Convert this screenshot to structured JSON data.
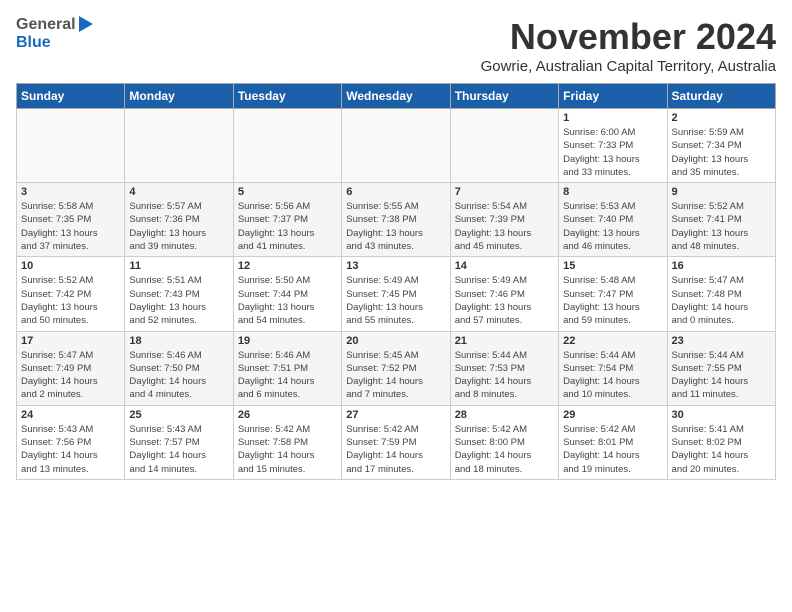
{
  "header": {
    "logo_general": "General",
    "logo_blue": "Blue",
    "month": "November 2024",
    "location": "Gowrie, Australian Capital Territory, Australia"
  },
  "weekdays": [
    "Sunday",
    "Monday",
    "Tuesday",
    "Wednesday",
    "Thursday",
    "Friday",
    "Saturday"
  ],
  "weeks": [
    [
      {
        "day": "",
        "info": ""
      },
      {
        "day": "",
        "info": ""
      },
      {
        "day": "",
        "info": ""
      },
      {
        "day": "",
        "info": ""
      },
      {
        "day": "",
        "info": ""
      },
      {
        "day": "1",
        "info": "Sunrise: 6:00 AM\nSunset: 7:33 PM\nDaylight: 13 hours\nand 33 minutes."
      },
      {
        "day": "2",
        "info": "Sunrise: 5:59 AM\nSunset: 7:34 PM\nDaylight: 13 hours\nand 35 minutes."
      }
    ],
    [
      {
        "day": "3",
        "info": "Sunrise: 5:58 AM\nSunset: 7:35 PM\nDaylight: 13 hours\nand 37 minutes."
      },
      {
        "day": "4",
        "info": "Sunrise: 5:57 AM\nSunset: 7:36 PM\nDaylight: 13 hours\nand 39 minutes."
      },
      {
        "day": "5",
        "info": "Sunrise: 5:56 AM\nSunset: 7:37 PM\nDaylight: 13 hours\nand 41 minutes."
      },
      {
        "day": "6",
        "info": "Sunrise: 5:55 AM\nSunset: 7:38 PM\nDaylight: 13 hours\nand 43 minutes."
      },
      {
        "day": "7",
        "info": "Sunrise: 5:54 AM\nSunset: 7:39 PM\nDaylight: 13 hours\nand 45 minutes."
      },
      {
        "day": "8",
        "info": "Sunrise: 5:53 AM\nSunset: 7:40 PM\nDaylight: 13 hours\nand 46 minutes."
      },
      {
        "day": "9",
        "info": "Sunrise: 5:52 AM\nSunset: 7:41 PM\nDaylight: 13 hours\nand 48 minutes."
      }
    ],
    [
      {
        "day": "10",
        "info": "Sunrise: 5:52 AM\nSunset: 7:42 PM\nDaylight: 13 hours\nand 50 minutes."
      },
      {
        "day": "11",
        "info": "Sunrise: 5:51 AM\nSunset: 7:43 PM\nDaylight: 13 hours\nand 52 minutes."
      },
      {
        "day": "12",
        "info": "Sunrise: 5:50 AM\nSunset: 7:44 PM\nDaylight: 13 hours\nand 54 minutes."
      },
      {
        "day": "13",
        "info": "Sunrise: 5:49 AM\nSunset: 7:45 PM\nDaylight: 13 hours\nand 55 minutes."
      },
      {
        "day": "14",
        "info": "Sunrise: 5:49 AM\nSunset: 7:46 PM\nDaylight: 13 hours\nand 57 minutes."
      },
      {
        "day": "15",
        "info": "Sunrise: 5:48 AM\nSunset: 7:47 PM\nDaylight: 13 hours\nand 59 minutes."
      },
      {
        "day": "16",
        "info": "Sunrise: 5:47 AM\nSunset: 7:48 PM\nDaylight: 14 hours\nand 0 minutes."
      }
    ],
    [
      {
        "day": "17",
        "info": "Sunrise: 5:47 AM\nSunset: 7:49 PM\nDaylight: 14 hours\nand 2 minutes."
      },
      {
        "day": "18",
        "info": "Sunrise: 5:46 AM\nSunset: 7:50 PM\nDaylight: 14 hours\nand 4 minutes."
      },
      {
        "day": "19",
        "info": "Sunrise: 5:46 AM\nSunset: 7:51 PM\nDaylight: 14 hours\nand 6 minutes."
      },
      {
        "day": "20",
        "info": "Sunrise: 5:45 AM\nSunset: 7:52 PM\nDaylight: 14 hours\nand 7 minutes."
      },
      {
        "day": "21",
        "info": "Sunrise: 5:44 AM\nSunset: 7:53 PM\nDaylight: 14 hours\nand 8 minutes."
      },
      {
        "day": "22",
        "info": "Sunrise: 5:44 AM\nSunset: 7:54 PM\nDaylight: 14 hours\nand 10 minutes."
      },
      {
        "day": "23",
        "info": "Sunrise: 5:44 AM\nSunset: 7:55 PM\nDaylight: 14 hours\nand 11 minutes."
      }
    ],
    [
      {
        "day": "24",
        "info": "Sunrise: 5:43 AM\nSunset: 7:56 PM\nDaylight: 14 hours\nand 13 minutes."
      },
      {
        "day": "25",
        "info": "Sunrise: 5:43 AM\nSunset: 7:57 PM\nDaylight: 14 hours\nand 14 minutes."
      },
      {
        "day": "26",
        "info": "Sunrise: 5:42 AM\nSunset: 7:58 PM\nDaylight: 14 hours\nand 15 minutes."
      },
      {
        "day": "27",
        "info": "Sunrise: 5:42 AM\nSunset: 7:59 PM\nDaylight: 14 hours\nand 17 minutes."
      },
      {
        "day": "28",
        "info": "Sunrise: 5:42 AM\nSunset: 8:00 PM\nDaylight: 14 hours\nand 18 minutes."
      },
      {
        "day": "29",
        "info": "Sunrise: 5:42 AM\nSunset: 8:01 PM\nDaylight: 14 hours\nand 19 minutes."
      },
      {
        "day": "30",
        "info": "Sunrise: 5:41 AM\nSunset: 8:02 PM\nDaylight: 14 hours\nand 20 minutes."
      }
    ]
  ]
}
